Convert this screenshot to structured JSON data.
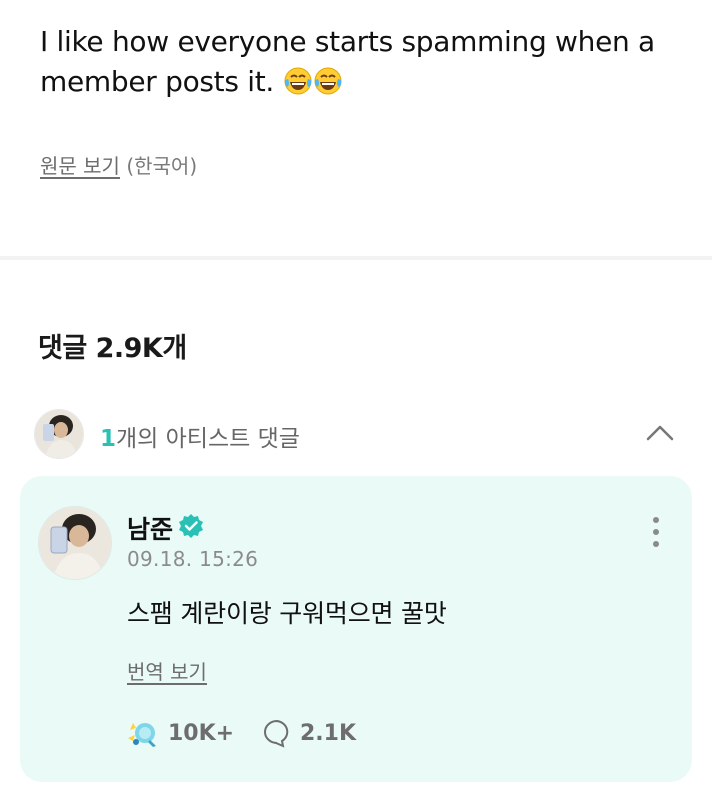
{
  "post": {
    "text": "I like how everyone starts spamming when a member posts it.",
    "emojis": [
      "face-with-tears-of-joy",
      "face-with-tears-of-joy"
    ],
    "view_original_label": "원문 보기",
    "original_language": "(한국어)"
  },
  "comments": {
    "header": "댓글 2.9K개",
    "artist_comments_count": "1",
    "artist_comments_label": "개의 아티스트 댓글",
    "featured": {
      "author": "남준",
      "verified": true,
      "timestamp": "09.18. 15:26",
      "body": "스팸 계란이랑 구워먹으면 꿀맛",
      "view_translation_label": "번역 보기",
      "reactions": "10K+",
      "replies": "2.1K"
    }
  },
  "colors": {
    "accent": "#29c0b5",
    "card_background": "#eafaf7",
    "muted_text": "#6d6d6d"
  }
}
